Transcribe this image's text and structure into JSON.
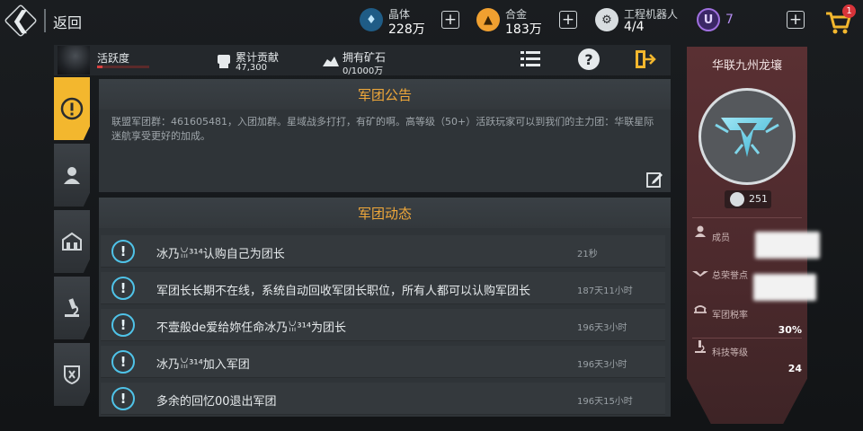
{
  "topbar": {
    "back_label": "返回",
    "resources": [
      {
        "name": "晶体",
        "value": "228万",
        "icon": "crystal-icon",
        "color": "#4fb8e8"
      },
      {
        "name": "合金",
        "value": "183万",
        "icon": "alloy-icon",
        "color": "#f0a030"
      },
      {
        "name": "工程机器人",
        "value": "4/4",
        "icon": "robot-icon",
        "color": "#e6eaec"
      },
      {
        "name": "",
        "value": "7",
        "icon": "u-currency-icon",
        "color": "#a070e0"
      }
    ],
    "notification_badge": "1"
  },
  "strip": {
    "activity_label": "活跃度",
    "activity_level": 0.1,
    "contribution_label": "累计贡献",
    "contribution_value": "47,300",
    "ore_label": "拥有矿石",
    "ore_value": "0/1000万"
  },
  "notice": {
    "title": "军团公告",
    "text": "联盟军团群：461605481，入团加群。星域战多打打，有矿的啊。高等级（50+）活跃玩家可以到我们的主力团：华联星际迷航享受更好的加成。"
  },
  "feed": {
    "title": "军团动态",
    "items": [
      {
        "text": "冰乃ꈍ³¹⁴认购自己为团长",
        "time": "21秒"
      },
      {
        "text": "军团长长期不在线，系统自动回收军团长职位，所有人都可以认购军团长",
        "time": "187天11小时"
      },
      {
        "text": "不壹般de爱给妳任命冰乃ꈍ³¹⁴为团长",
        "time": "196天3小时"
      },
      {
        "text": "冰乃ꈍ³¹⁴加入军团",
        "time": "196天3小时"
      },
      {
        "text": "多余的回忆00退出军团",
        "time": "196天15小时"
      }
    ]
  },
  "card": {
    "name": "华联九州龙壤",
    "power": "251",
    "members_label": "成员",
    "honor_label": "总荣誉点",
    "tax_label": "军团税率",
    "tax_value": "30%",
    "tech_label": "科技等级",
    "tech_value": "24"
  },
  "colors": {
    "accent": "#f0a83a",
    "tab_active": "#f3b72e",
    "feed_icon": "#4fc3e8",
    "card": "#5a3033"
  }
}
